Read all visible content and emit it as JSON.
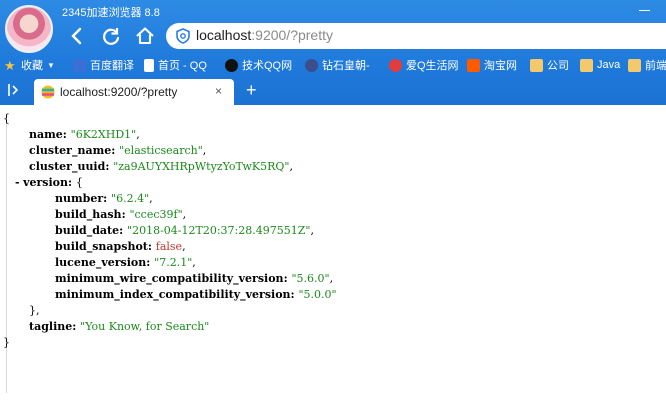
{
  "browser": {
    "app_title": "2345加速浏览器 8.8",
    "address": {
      "host": "localhost",
      "rest": ":9200/?pretty"
    },
    "bookmarks": [
      {
        "label": "收藏",
        "icon": "star-icon",
        "color": "#f5c242",
        "dropdown": true
      },
      {
        "label": "百度翻译",
        "icon": "translate-icon",
        "color": "#3a6fd8"
      },
      {
        "label": "首页 - QQ",
        "icon": "page-icon",
        "color": "#ffffff"
      },
      {
        "label": "技术QQ网",
        "icon": "qq-icon",
        "color": "#111111"
      },
      {
        "label": "钻石皇朝-",
        "icon": "zshc-icon",
        "color": "#3b4d8a"
      },
      {
        "label": "爱Q生活网",
        "icon": "aiq-icon",
        "color": "#e23c3c"
      },
      {
        "label": "淘宝网",
        "icon": "taobao-icon",
        "color": "#ff5a00"
      },
      {
        "label": "公司",
        "icon": "folder-icon",
        "color": "#f3c96b"
      },
      {
        "label": "Java",
        "icon": "folder-icon",
        "color": "#f3c96b"
      },
      {
        "label": "前端",
        "icon": "folder-icon",
        "color": "#f3c96b"
      }
    ],
    "tab": {
      "title": "localhost:9200/?pretty",
      "close": "×"
    },
    "new_tab": "+"
  },
  "json_view": {
    "open_brace": "{",
    "close_brace": "}",
    "name": {
      "key": "name",
      "value": "\"6K2XHD1\""
    },
    "cluster_name": {
      "key": "cluster_name",
      "value": "\"elasticsearch\""
    },
    "cluster_uuid": {
      "key": "cluster_uuid",
      "value": "\"za9AUYXHRpWtyzYoTwK5RQ\""
    },
    "version": {
      "toggle": "-",
      "key": "version",
      "open": "{",
      "close": "},",
      "number": {
        "key": "number",
        "value": "\"6.2.4\""
      },
      "build_hash": {
        "key": "build_hash",
        "value": "\"ccec39f\""
      },
      "build_date": {
        "key": "build_date",
        "value": "\"2018-04-12T20:37:28.497551Z\""
      },
      "build_snapshot": {
        "key": "build_snapshot",
        "value": "false"
      },
      "lucene_version": {
        "key": "lucene_version",
        "value": "\"7.2.1\""
      },
      "min_wire": {
        "key": "minimum_wire_compatibility_version",
        "value": "\"5.6.0\""
      },
      "min_index": {
        "key": "minimum_index_compatibility_version",
        "value": "\"5.0.0\""
      }
    },
    "tagline": {
      "key": "tagline",
      "value": "\"You Know, for Search\""
    }
  },
  "colors": {
    "chrome": "#1f7adb",
    "string": "#1a8a1a",
    "boolean": "#c0392b"
  }
}
